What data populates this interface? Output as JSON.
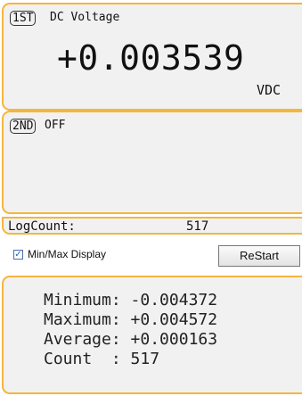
{
  "panel1": {
    "tag": "1ST",
    "title": "DC Voltage",
    "reading": "+0.003539",
    "unit": "VDC"
  },
  "panel2": {
    "tag": "2ND",
    "title": "OFF"
  },
  "log": {
    "label": "LogCount:",
    "value": "517"
  },
  "options": {
    "checkbox_checked": true,
    "checkbox_label": "Min/Max Display",
    "restart_label": "ReStart"
  },
  "stats": {
    "rows": [
      {
        "label": "Minimum: ",
        "value": "-0.004372"
      },
      {
        "label": "Maximum: ",
        "value": "+0.004572"
      },
      {
        "label": "Average: ",
        "value": "+0.000163"
      },
      {
        "label": "Count  : ",
        "value": "517"
      }
    ]
  },
  "colors": {
    "panel_border": "#f4b63c",
    "panel_bg": "#f1f1f1"
  }
}
